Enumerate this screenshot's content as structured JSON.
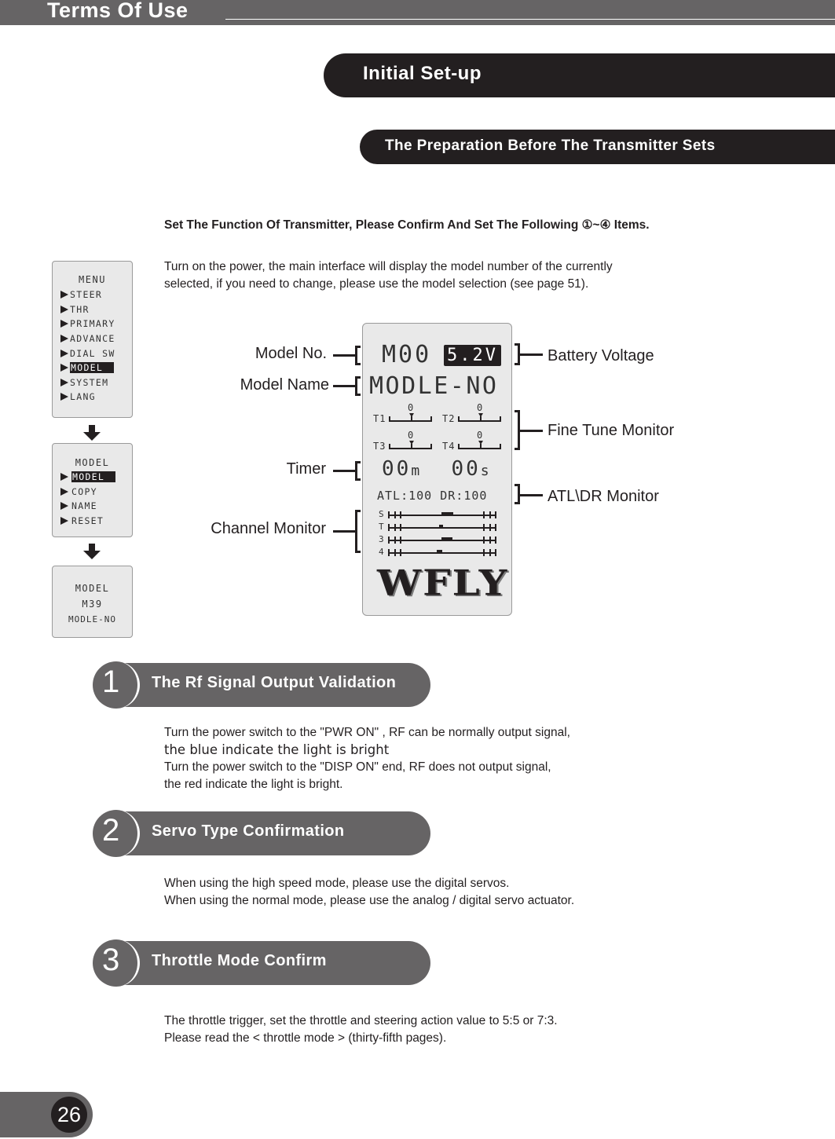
{
  "header": {
    "section_title": "Terms Of Use"
  },
  "page_title": "Initial Set-up",
  "subsection_title": "The Preparation Before The Transmitter Sets",
  "lead_text": "Set The Function Of Transmitter, Please Confirm And Set The Following ①~④ Items.",
  "intro_lines": [
    "Turn on the power, the main interface will display the model number of the currently",
    "selected, if you  need to change, please use the model selection (see page 51)."
  ],
  "menu_screens": {
    "menu": {
      "title": "MENU",
      "items": [
        "STEER",
        "THR",
        "PRIMARY",
        "ADVANCE",
        "DIAL SW",
        "MODEL",
        "SYSTEM",
        "LANG"
      ],
      "selected": "MODEL"
    },
    "model": {
      "title": "MODEL",
      "items": [
        "MODEL",
        "COPY",
        "NAME",
        "RESET"
      ],
      "selected": "MODEL"
    },
    "final": {
      "lines": [
        "MODEL",
        "M39",
        "MODLE-NO"
      ]
    }
  },
  "main_display": {
    "model_no": "M00",
    "battery_voltage": "5.2V",
    "model_name": "MODLE-NO",
    "trims": [
      {
        "label": "T1",
        "value": "0"
      },
      {
        "label": "T2",
        "value": "0"
      },
      {
        "label": "T3",
        "value": "0"
      },
      {
        "label": "T4",
        "value": "0"
      }
    ],
    "timer_min": "00",
    "timer_min_unit": "m",
    "timer_sec": "00",
    "timer_sec_unit": "s",
    "atl_dr": "ATL:100  DR:100",
    "channels": [
      {
        "label": "S"
      },
      {
        "label": "T"
      },
      {
        "label": "3"
      },
      {
        "label": "4"
      }
    ],
    "logo": "WFLY"
  },
  "callouts": {
    "left": [
      "Model No.",
      "Model Name",
      "Timer",
      "Channel Monitor"
    ],
    "right": [
      "Battery Voltage",
      "Fine Tune Monitor",
      "ATL\\DR  Monitor"
    ]
  },
  "sections": [
    {
      "number": "1",
      "title": "The Rf Signal Output Validation",
      "lines": [
        "Turn the power switch to the \"PWR ON\" , RF can be normally output signal,",
        "the blue indicate the light is bright",
        "Turn the power switch to the \"DISP ON\" end, RF does not output signal,",
        "the red indicate the light is bright."
      ]
    },
    {
      "number": "2",
      "title": "Servo Type Confirmation",
      "lines": [
        "When using the high speed mode, please use the digital servos.",
        "When using the normal mode, please use the analog / digital servo actuator."
      ]
    },
    {
      "number": "3",
      "title": "Throttle Mode Confirm",
      "lines": [
        "The throttle trigger, set  the throttle and steering action value to 5:5 or 7:3.",
        "Please read the < throttle mode > (thirty-fifth pages)."
      ]
    }
  ],
  "footer": {
    "page_number": "26"
  },
  "colors": {
    "dark": "#231f20",
    "gray_band": "#666465",
    "lcd_background": "#e9e9e9"
  }
}
